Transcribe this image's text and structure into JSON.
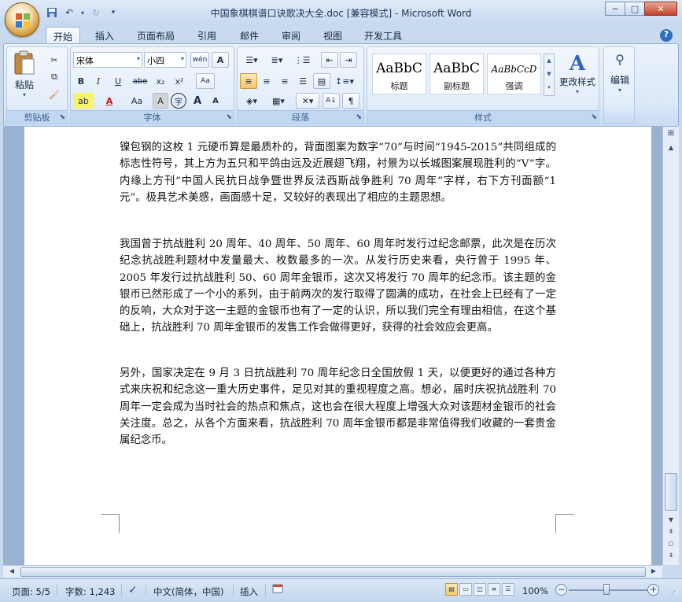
{
  "window": {
    "title": "中国象棋棋谱口诀歌决大全.doc [兼容模式] - Microsoft Word",
    "controls": [
      "─",
      "□",
      "✕"
    ]
  },
  "quick_access": {
    "save": "save-icon",
    "undo": "undo-icon",
    "redo": "redo-icon",
    "more": "▾"
  },
  "tabs": [
    "开始",
    "插入",
    "页面布局",
    "引用",
    "邮件",
    "审阅",
    "视图",
    "开发工具"
  ],
  "active_tab": "开始",
  "ribbon": {
    "clipboard": {
      "paste_label": "粘贴",
      "group_label": "剪贴板"
    },
    "font": {
      "font_name": "宋体",
      "font_size": "小四",
      "pinyin_btn": "wén",
      "border_btn": "A",
      "bold": "B",
      "italic": "I",
      "underline": "U",
      "strike": "abe",
      "sub": "x₂",
      "sup": "x²",
      "clear": "Aa",
      "highlight": "ab",
      "color": "A",
      "case": "Aa",
      "shade": "A",
      "circle": "字",
      "grow": "A",
      "shrink": "A",
      "group_label": "字体"
    },
    "paragraph": {
      "group_label": "段落"
    },
    "styles": {
      "items": [
        {
          "sample": "AaBbC",
          "name": "标题"
        },
        {
          "sample": "AaBbC",
          "name": "副标题"
        },
        {
          "sample": "AaBbCcD",
          "name": "强调"
        }
      ],
      "change_label": "更改样式",
      "group_label": "样式"
    },
    "editing": {
      "label": "编辑"
    }
  },
  "document": {
    "paragraphs": [
      "镍包钢的这枚 1 元硬币算是最质朴的，背面图案为数字“70”与时间“1945-2015”共同组成的标志性符号，其上方为五只和平鸽由远及近展翅飞翔，衬景为以长城图案展现胜利的“V”字。内缘上方刊“中国人民抗日战争暨世界反法西斯战争胜利 70 周年”字样，右下方刊面额“1 元”。极具艺术美感，画面感十足，又较好的表现出了相应的主题思想。",
      "我国曾于抗战胜利 20 周年、40 周年、50 周年、60 周年时发行过纪念邮票，此次是在历次纪念抗战胜利题材中发量最大、枚数最多的一次。从发行历史来看，央行曾于 1995 年、2005 年发行过抗战胜利 50、60 周年金银币，这次又将发行 70 周年的纪念币。该主题的金银币已然形成了一个小的系列，由于前两次的发行取得了圆满的成功，在社会上已经有了一定的反响，大众对于这一主题的金银币也有了一定的认识，所以我们完全有理由相信，在这个基础上，抗战胜利 70 周年金银币的发售工作会做得更好，获得的社会效应会更高。",
      "另外，国家决定在 9 月 3 日抗战胜利 70 周年纪念日全国放假 1 天，以便更好的通过各种方式来庆祝和纪念这一重大历史事件，足见对其的重视程度之高。想必，届时庆祝抗战胜利 70 周年一定会成为当时社会的热点和焦点，这也会在很大程度上增强大众对该题材金银币的社会关注度。总之，从各个方面来看，抗战胜利 70 周年金银币都是非常值得我们收藏的一套贵金属纪念币。"
    ]
  },
  "status": {
    "page": "页面: 5/5",
    "words": "字数: 1,243",
    "language": "中文(简体，中国)",
    "mode": "插入",
    "zoom": "100%",
    "zoom_minus": "−",
    "zoom_plus": "+"
  }
}
